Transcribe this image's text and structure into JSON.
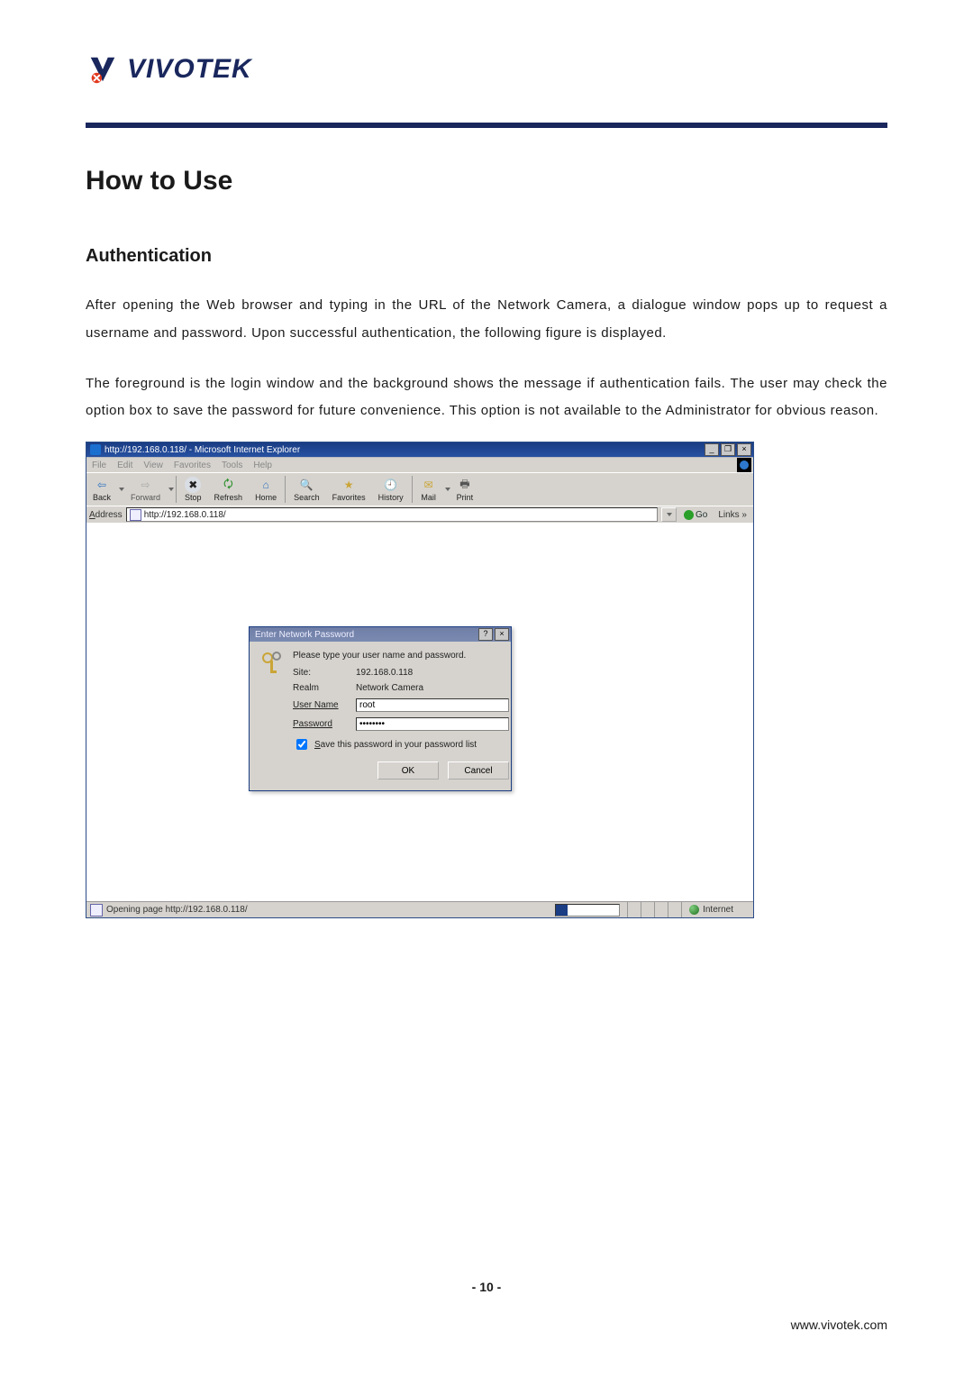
{
  "logo_text": "VIVOTEK",
  "h1": "How to Use",
  "h2": "Authentication",
  "para1": "After opening the Web browser and typing in the URL of the Network Camera, a dialogue window pops up to request a username and password. Upon successful authentication, the following figure is displayed.",
  "para2": "The foreground is the login window and the background shows the message if authentication fails. The user may check the option box to save the password for future convenience.  This option is not available to the Administrator for obvious reason.",
  "page_num": "- 10 -",
  "footer_url": "www.vivotek.com",
  "ie": {
    "title": "http://192.168.0.118/ - Microsoft Internet Explorer",
    "menus": [
      "File",
      "Edit",
      "View",
      "Favorites",
      "Tools",
      "Help"
    ],
    "tools": {
      "back": "Back",
      "forward": "Forward",
      "stop": "Stop",
      "refresh": "Refresh",
      "home": "Home",
      "search": "Search",
      "favorites": "Favorites",
      "history": "History",
      "mail": "Mail",
      "print": "Print"
    },
    "address_label": "Address",
    "address_value": "http://192.168.0.118/",
    "go_label": "Go",
    "links_label": "Links »",
    "status_text": "Opening page http://192.168.0.118/",
    "zone": "Internet"
  },
  "dialog": {
    "title": "Enter Network Password",
    "prompt": "Please type your user name and password.",
    "site_label": "Site:",
    "site_value": "192.168.0.118",
    "realm_label": "Realm",
    "realm_value": "Network Camera",
    "user_label_pre": "U",
    "user_label": "ser Name",
    "user_value": "root",
    "pass_label_pre": "P",
    "pass_label": "assword",
    "pass_value": "••••••••",
    "save_pre": "S",
    "save_label": "ave this password in your password list",
    "ok": "OK",
    "cancel": "Cancel"
  }
}
